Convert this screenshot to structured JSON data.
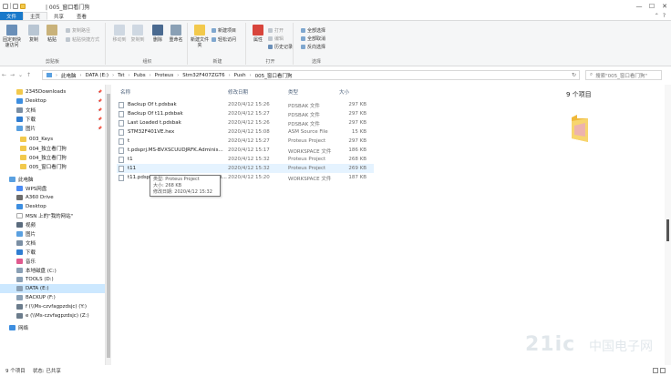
{
  "window": {
    "title": "| 005_窗口看门狗",
    "controls": [
      "—",
      "☐",
      "✕"
    ]
  },
  "tabs": [
    "文件",
    "主页",
    "共享",
    "查看"
  ],
  "ribbon": {
    "pin": "固定到快速访问",
    "copy": "复制",
    "paste": "粘贴",
    "copy_path": "复制路径",
    "paste_shortcut": "粘贴快捷方式",
    "clipboard": "剪贴板",
    "move_to": "移动到",
    "copy_to": "复制到",
    "delete": "删除",
    "rename": "重命名",
    "organize": "组织",
    "new_folder": "新建文件夹",
    "new_item": "新建项目",
    "easy_access": "轻松访问",
    "new": "新建",
    "properties": "属性",
    "open": "打开",
    "edit": "编辑",
    "history": "历史记录",
    "open_group": "打开",
    "select_all": "全部选择",
    "select_none": "全部取消",
    "invert": "反向选择",
    "select": "选择"
  },
  "address": {
    "crumbs": [
      "此电脑",
      "DATA (E:)",
      "Tst",
      "Pubs",
      "Proteus",
      "Stm32F407ZGT6",
      "Push",
      "005_窗口看门狗"
    ],
    "search_placeholder": "搜索\"005_窗口看门狗\""
  },
  "nav": [
    {
      "label": "2345Downloads",
      "pinned": true,
      "color": "#f2c94c"
    },
    {
      "label": "Desktop",
      "pinned": true,
      "color": "#3d8ee0"
    },
    {
      "label": "文档",
      "pinned": true,
      "color": "#7a8ea3"
    },
    {
      "label": "下载",
      "pinned": true,
      "color": "#2f7dd1"
    },
    {
      "label": "图片",
      "pinned": true,
      "color": "#5aa0e0"
    },
    {
      "label": "003_Keys",
      "pinned": false,
      "color": "#f2c94c"
    },
    {
      "label": "004_独立看门狗",
      "pinned": false,
      "color": "#f2c94c"
    },
    {
      "label": "004_独立看门狗",
      "pinned": false,
      "color": "#f2c94c"
    },
    {
      "label": "005_窗口看门狗",
      "pinned": false,
      "color": "#f2c94c"
    },
    {
      "label": "此电脑",
      "pinned": false,
      "color": "#5aa0e0"
    },
    {
      "label": "WPS网盘",
      "pinned": false,
      "color": "#4b8bf4"
    },
    {
      "label": "A360 Drive",
      "pinned": false,
      "color": "#6d6d6d"
    },
    {
      "label": "Desktop",
      "pinned": false,
      "color": "#3d8ee0"
    },
    {
      "label": "MSN 上的\"我的网站\"",
      "pinned": false,
      "color": "#ffffff"
    },
    {
      "label": "视频",
      "pinned": false,
      "color": "#5a6b7d"
    },
    {
      "label": "图片",
      "pinned": false,
      "color": "#5aa0e0"
    },
    {
      "label": "文档",
      "pinned": false,
      "color": "#7a8ea3"
    },
    {
      "label": "下载",
      "pinned": false,
      "color": "#2f7dd1"
    },
    {
      "label": "音乐",
      "pinned": false,
      "color": "#e05a8e"
    },
    {
      "label": "本地磁盘 (C:)",
      "pinned": false,
      "color": "#8aa0b5"
    },
    {
      "label": "TOOLS (D:)",
      "pinned": false,
      "color": "#8aa0b5"
    },
    {
      "label": "DATA (E:)",
      "pinned": false,
      "color": "#8aa0b5",
      "selected": true
    },
    {
      "label": "BACKUP (F:)",
      "pinned": false,
      "color": "#8aa0b5"
    },
    {
      "label": "f (\\\\Ms-czvfagpzdsjc) (Y:)",
      "pinned": false,
      "color": "#6b7c8c"
    },
    {
      "label": "e (\\\\Ms-czvfagpzdsjc) (Z:)",
      "pinned": false,
      "color": "#6b7c8c"
    },
    {
      "label": "网络",
      "pinned": false,
      "color": "#3d8ee0"
    }
  ],
  "columns": {
    "name": "名称",
    "date": "修改日期",
    "type": "类型",
    "size": "大小"
  },
  "files": [
    {
      "name": "Backup Of t.pdsbak",
      "date": "2020/4/12 15:26",
      "type": "PDSBAK 文件",
      "size": "297 KB"
    },
    {
      "name": "Backup Of t11.pdsbak",
      "date": "2020/4/12 15:27",
      "type": "PDSBAK 文件",
      "size": "297 KB"
    },
    {
      "name": "Last Loaded t.pdsbak",
      "date": "2020/4/12 15:26",
      "type": "PDSBAK 文件",
      "size": "297 KB"
    },
    {
      "name": "STM32F401VE.hex",
      "date": "2020/4/12 15:08",
      "type": "ASM Source File",
      "size": "15 KB"
    },
    {
      "name": "t",
      "date": "2020/4/12 15:27",
      "type": "Proteus Project",
      "size": "297 KB"
    },
    {
      "name": "t.pdsprj.MS-BVXSCUUDJRFK.Adminis...",
      "date": "2020/4/12 15:17",
      "type": "WORKSPACE 文件",
      "size": "186 KB"
    },
    {
      "name": "t1",
      "date": "2020/4/12 15:32",
      "type": "Proteus Project",
      "size": "268 KB"
    },
    {
      "name": "t11",
      "date": "2020/4/12 15:32",
      "type": "Proteus Project",
      "size": "269 KB"
    },
    {
      "name": "t11.pdsprj.MS-BVXSCUUDJRFK.Admini...",
      "date": "2020/4/12 15:20",
      "type": "WORKSPACE 文件",
      "size": "187 KB"
    }
  ],
  "tooltip": {
    "line1": "类型: Proteus Project",
    "line2": "大小: 268 KB",
    "line3": "修改日期: 2020/4/12 15:32"
  },
  "preview": {
    "count": "9 个项目"
  },
  "status": {
    "items": "9 个项目",
    "selected": "状态: 已共享"
  },
  "watermark": {
    "main": "21ic",
    "sub": "中国电子网"
  }
}
